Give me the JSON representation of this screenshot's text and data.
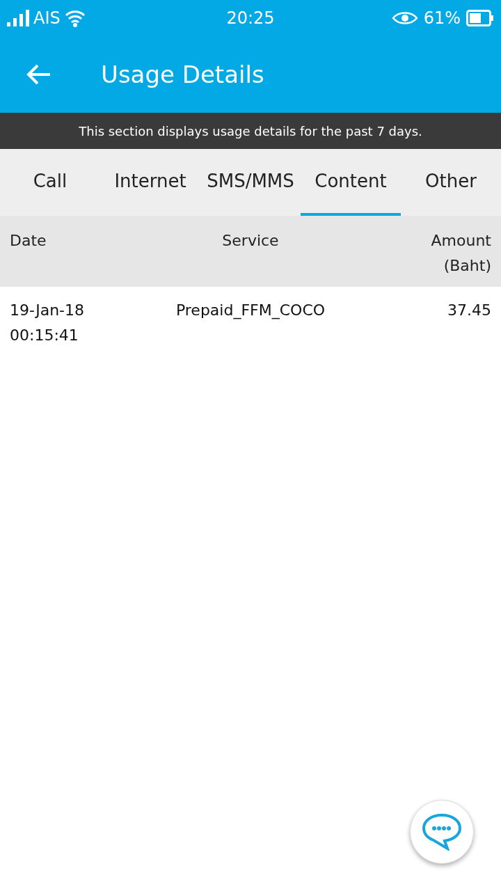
{
  "status_bar": {
    "carrier": "AIS",
    "time": "20:25",
    "battery": "61%"
  },
  "header": {
    "title": "Usage Details"
  },
  "notice": "This section displays usage details for the past 7 days.",
  "tabs": [
    {
      "label": "Call",
      "selected": false
    },
    {
      "label": "Internet",
      "selected": false
    },
    {
      "label": "SMS/MMS",
      "selected": false
    },
    {
      "label": "Content",
      "selected": true
    },
    {
      "label": "Other",
      "selected": false
    }
  ],
  "table": {
    "columns": [
      "Date",
      "Service",
      "Amount\n(Baht)"
    ],
    "rows": [
      {
        "date": "19-Jan-18\n00:15:41",
        "service": "Prepaid_FFM_COCO",
        "amount": "37.45"
      }
    ]
  }
}
